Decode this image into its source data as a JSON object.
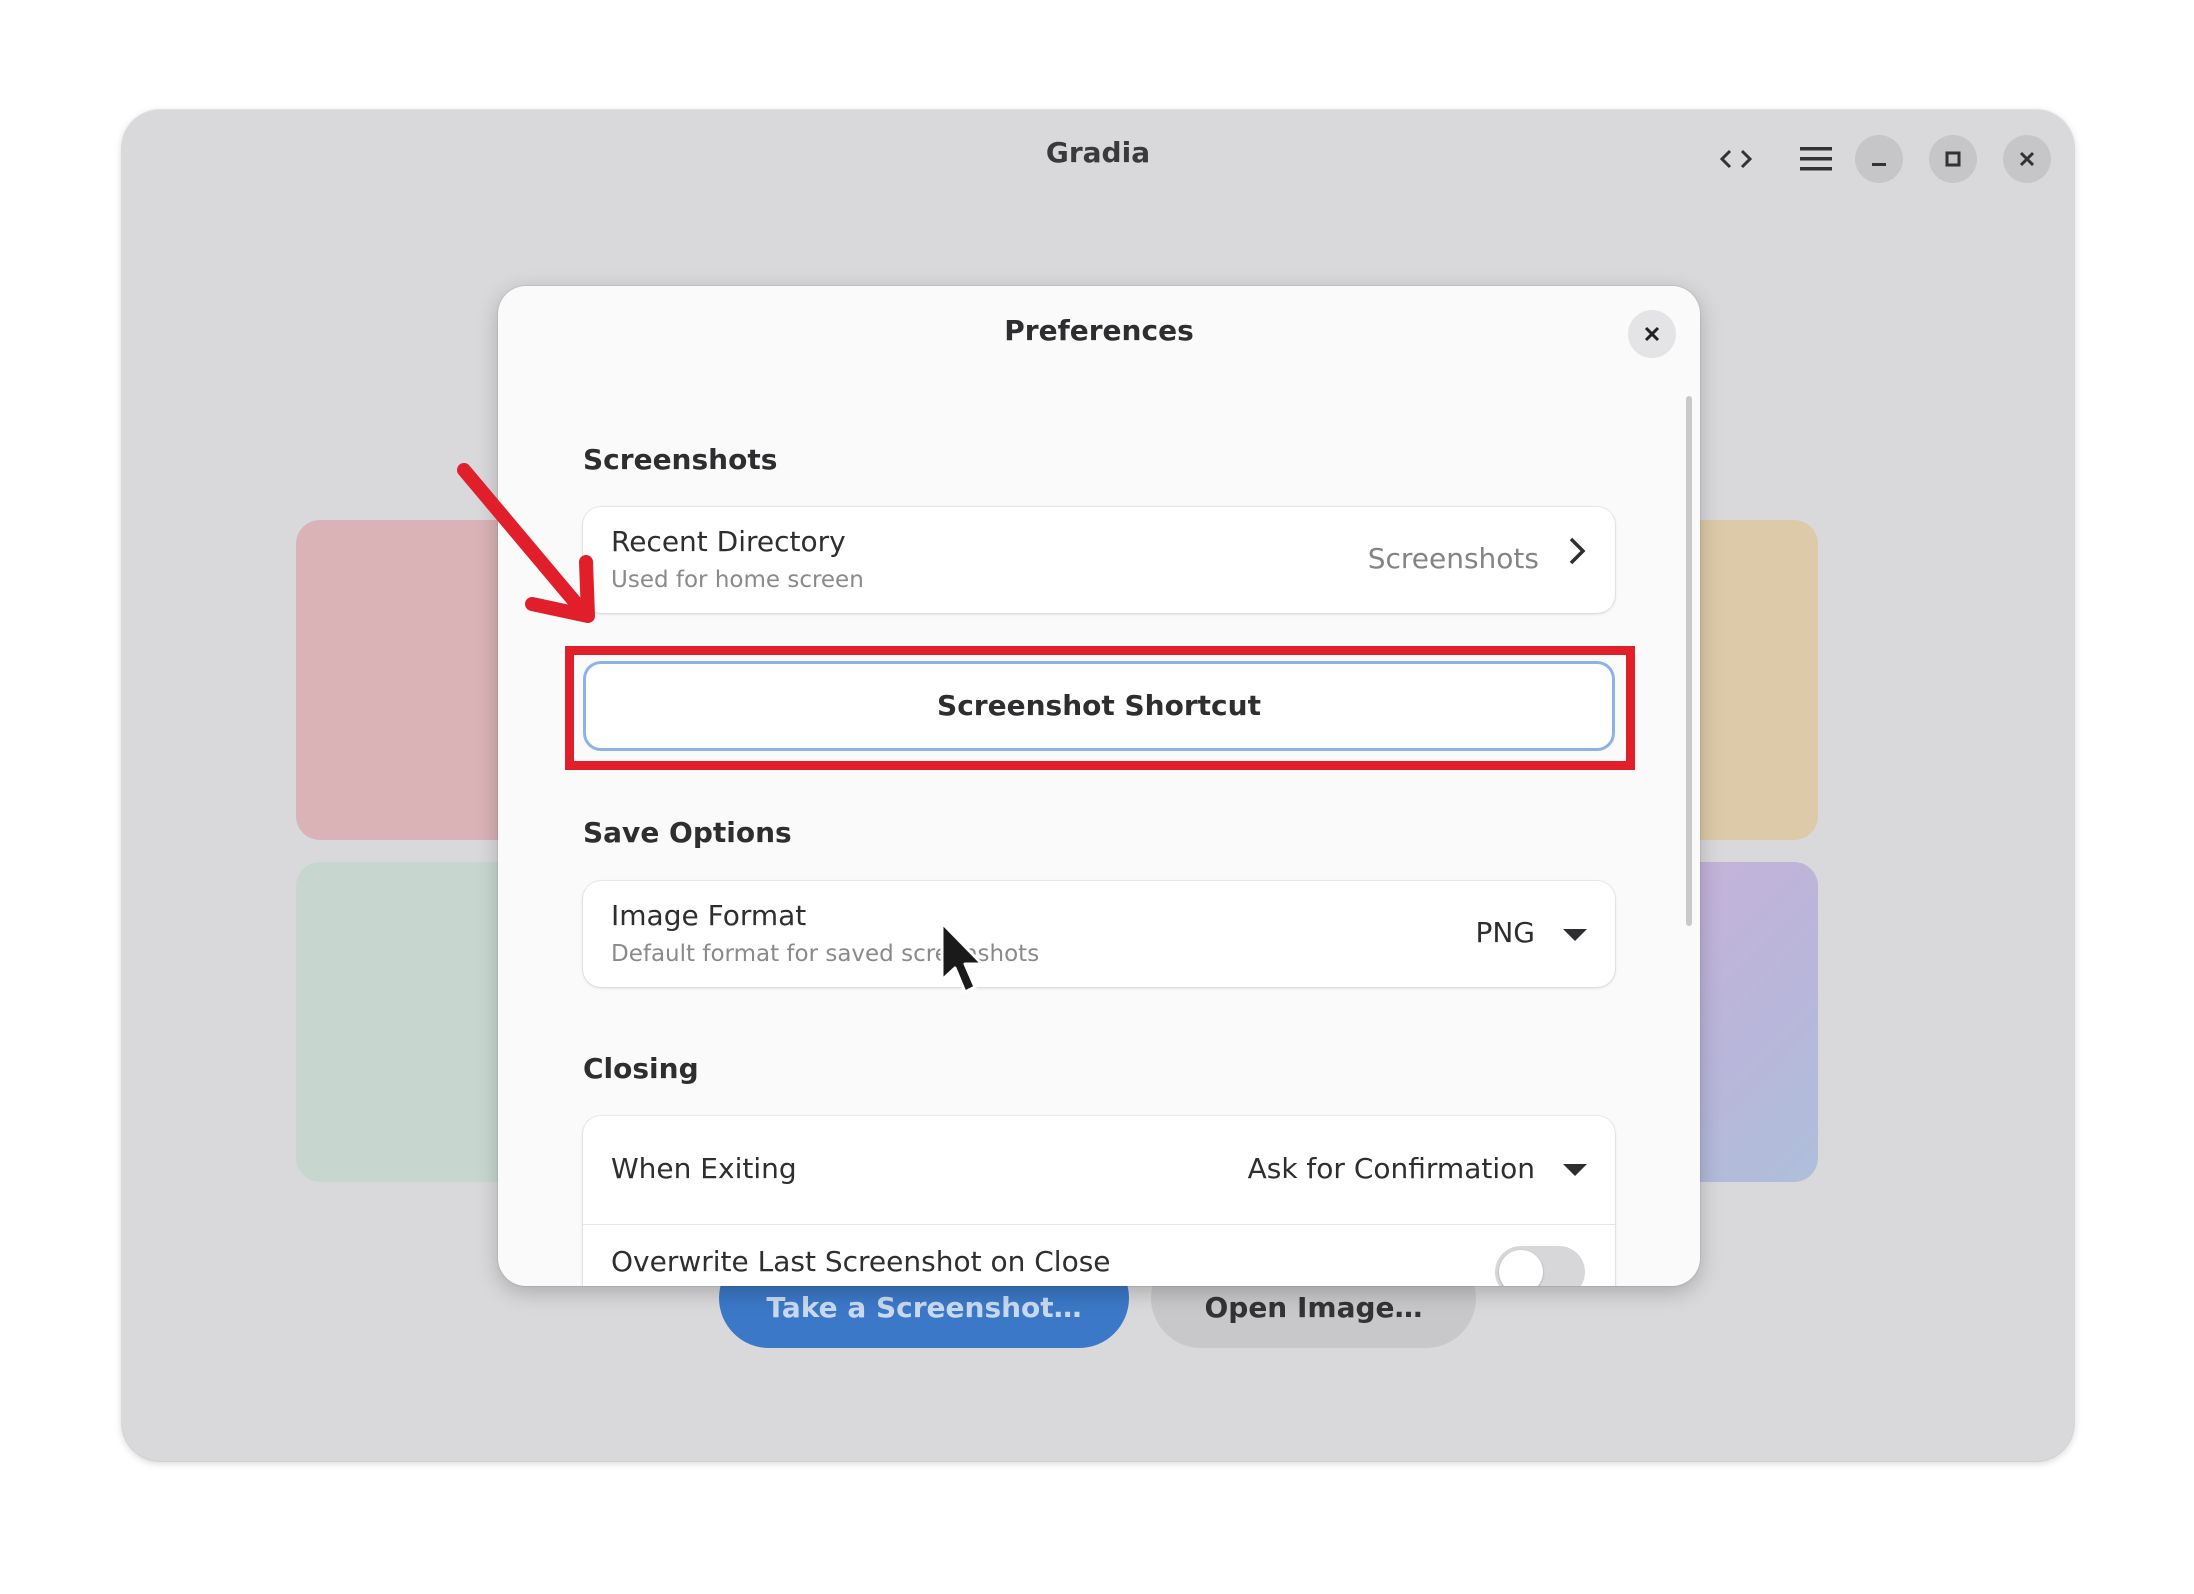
{
  "window": {
    "title": "Gradia",
    "controls": {
      "code_icon": "code-toggle-icon",
      "menu_icon": "hamburger-menu-icon",
      "minimize_icon": "minimize-icon",
      "maximize_icon": "maximize-icon",
      "close_icon": "close-icon"
    }
  },
  "background": {
    "primary_button": "Take a Screenshot…",
    "secondary_button": "Open Image…"
  },
  "dialog": {
    "title": "Preferences",
    "sections": {
      "screenshots": {
        "heading": "Screenshots",
        "recent_directory": {
          "title": "Recent Directory",
          "subtitle": "Used for home screen",
          "value": "Screenshots"
        },
        "shortcut_button": "Screenshot Shortcut"
      },
      "save_options": {
        "heading": "Save Options",
        "image_format": {
          "title": "Image Format",
          "subtitle": "Default format for saved screenshots",
          "value": "PNG"
        }
      },
      "closing": {
        "heading": "Closing",
        "when_exiting": {
          "title": "When Exiting",
          "value": "Ask for Confirmation"
        },
        "overwrite_last": {
          "title": "Overwrite Last Screenshot on Close",
          "enabled": false
        }
      }
    }
  },
  "colors": {
    "annotation_red": "#e01f2a",
    "accent_blue": "#3b78c7",
    "focus_ring": "#8db3e6"
  }
}
